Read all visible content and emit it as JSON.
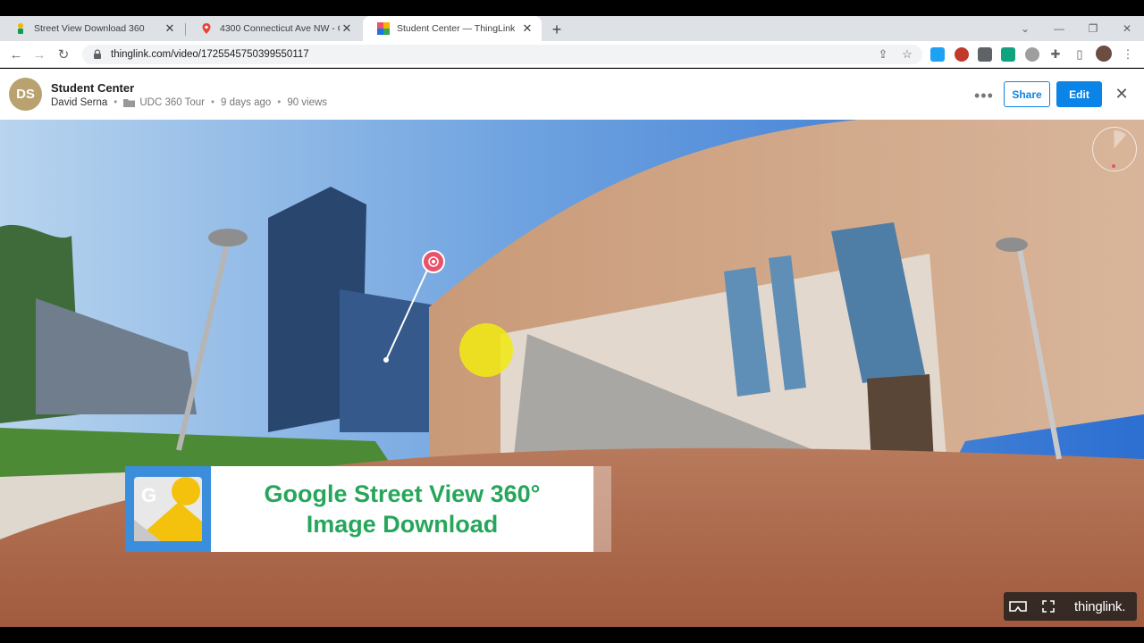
{
  "browser": {
    "tabs": [
      {
        "title": "Street View Download 360",
        "active": false,
        "icon": "street-view-download-favicon"
      },
      {
        "title": "4300 Connecticut Ave NW - Goo",
        "active": false,
        "icon": "google-maps-favicon"
      },
      {
        "title": "Student Center — ThingLink",
        "active": true,
        "icon": "thinglink-favicon"
      }
    ],
    "new_tab_label": "+",
    "url": "thinglink.com/video/1725545750399550117"
  },
  "header": {
    "avatar_initials": "DS",
    "title": "Student Center",
    "author": "David Serna",
    "folder": "UDC 360 Tour",
    "time_ago": "9 days ago",
    "views": "90 views",
    "share_label": "Share",
    "edit_label": "Edit"
  },
  "banner": {
    "line1": "Google Street View 360°",
    "line2": "Image Download"
  },
  "viewer_controls": {
    "brand": "thinglink."
  },
  "colors": {
    "accent": "#0a84e6",
    "avatar": "#b9a26f",
    "banner_text": "#26a65b",
    "hotspot": "#e8536a"
  }
}
